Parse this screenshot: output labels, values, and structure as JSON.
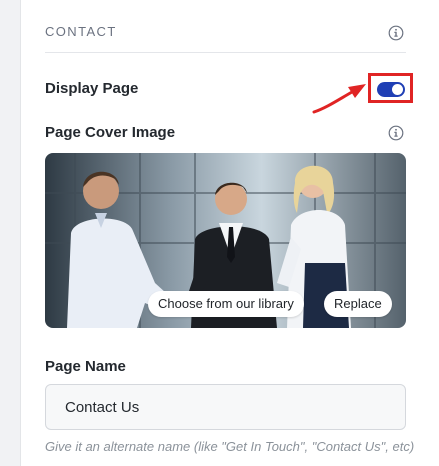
{
  "section": {
    "title": "CONTACT"
  },
  "display_page": {
    "label": "Display Page",
    "enabled": true
  },
  "cover": {
    "label": "Page Cover Image",
    "choose_library_label": "Choose from our library",
    "replace_label": "Replace"
  },
  "page_name": {
    "label": "Page Name",
    "value": "Contact Us",
    "hint": "Give it an alternate name (like \"Get In Touch\", \"Contact Us\", etc)"
  },
  "colors": {
    "toggle_on": "#1f3fb5",
    "annotation_red": "#e02424",
    "muted_text": "#6b7280"
  },
  "icons": [
    "info-icon",
    "toggle-switch",
    "annotation-arrow"
  ]
}
